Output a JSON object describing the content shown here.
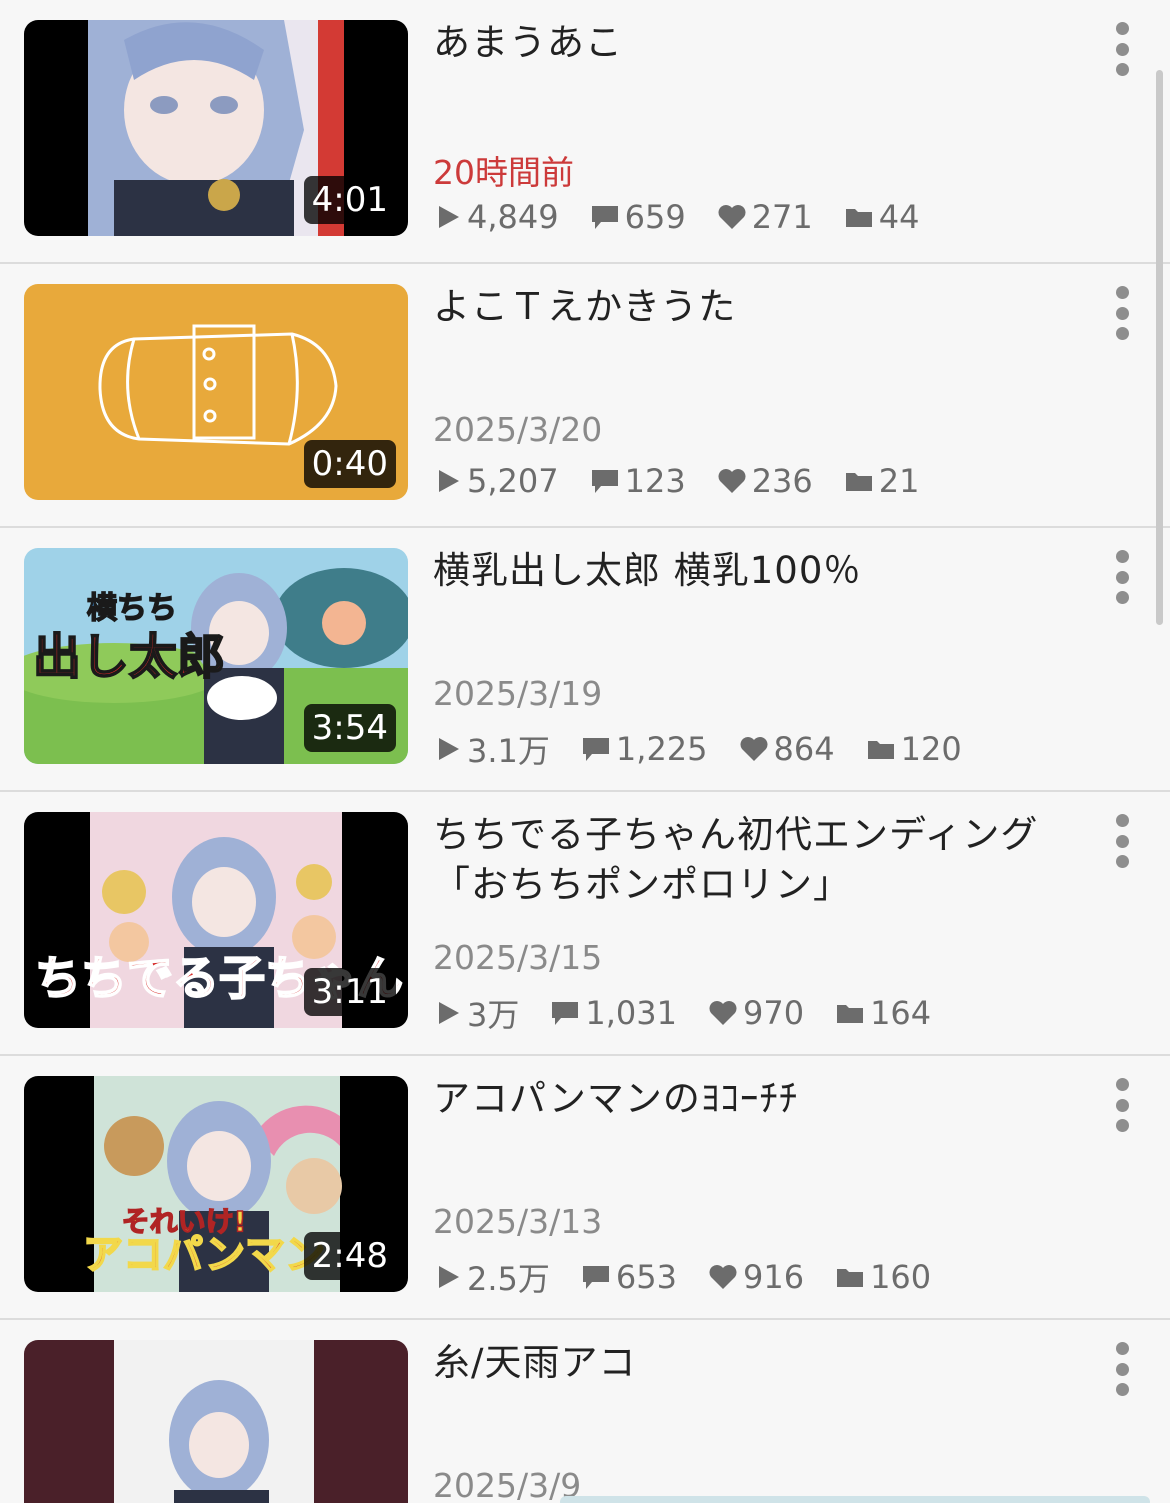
{
  "videos": [
    {
      "title": "あまうあこ",
      "date": "20時間前",
      "duration": "4:01",
      "views": "4,849",
      "comments": "659",
      "likes": "271",
      "mylists": "44"
    },
    {
      "title": "よこＴえかきうた",
      "date": "2025/3/20",
      "duration": "0:40",
      "views": "5,207",
      "comments": "123",
      "likes": "236",
      "mylists": "21"
    },
    {
      "title": "横乳出し太郎 横乳100％",
      "date": "2025/3/19",
      "duration": "3:54",
      "views": "3.1万",
      "comments": "1,225",
      "likes": "864",
      "mylists": "120"
    },
    {
      "title": "ちちでる子ちゃん初代エンディング「おちちポンポロリン」",
      "date": "2025/3/15",
      "duration": "3:11",
      "views": "3万",
      "comments": "1,031",
      "likes": "970",
      "mylists": "164"
    },
    {
      "title": "アコパンマンのﾖｺｰﾁﾁ",
      "date": "2025/3/13",
      "duration": "2:48",
      "views": "2.5万",
      "comments": "653",
      "likes": "916",
      "mylists": "160"
    },
    {
      "title": "糸/天雨アコ",
      "date": "2025/3/9"
    }
  ],
  "thumb_texts": {
    "t3_top": "横ちち",
    "t3_main": "出し太郎",
    "t4_main": "ちちでる子ちゃん",
    "t5_main": "それいけ!",
    "t5_sub": "アコパンマン"
  },
  "colors": {
    "recent_date": "#cc3a3a",
    "icon_gray": "#6c6c6c",
    "yellow_thumb": "#e8a93b"
  },
  "icons": {
    "views": "play-icon",
    "comments": "comment-icon",
    "likes": "heart-icon",
    "mylists": "folder-icon",
    "menu": "more-vert-icon"
  }
}
